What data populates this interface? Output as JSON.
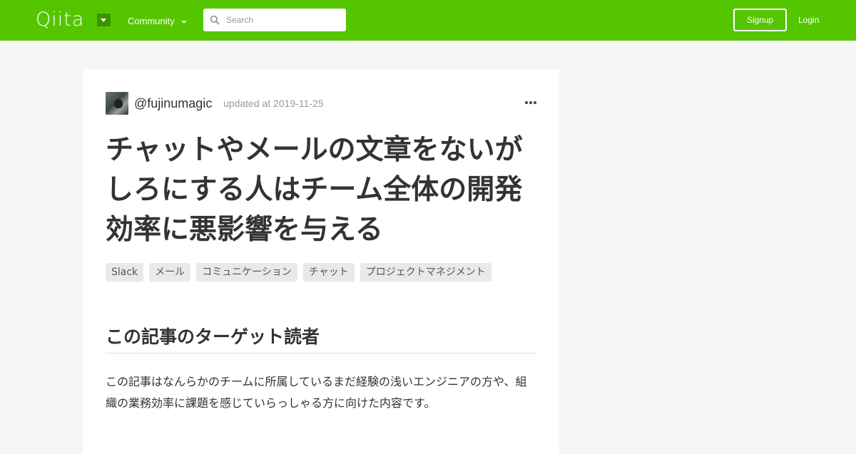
{
  "header": {
    "logo": "Qiita",
    "community_label": "Community",
    "search_placeholder": "Search",
    "signup_label": "Signup",
    "login_label": "Login",
    "brand_color": "#55c500"
  },
  "article": {
    "author": "@fujinumagic",
    "updated": "updated at 2019-11-25",
    "title": "チャットやメールの文章をないがしろにする人はチーム全体の開発効率に悪影響を与える",
    "tags": [
      "Slack",
      "メール",
      "コミュニケーション",
      "チャット",
      "プロジェクトマネジメント"
    ],
    "section_heading": "この記事のターゲット読者",
    "paragraph": "この記事はなんらかのチームに所属しているまだ経験の浅いエンジニアの方や、組織の業務効率に課題を感じていらっしゃる方に向けた内容です。"
  }
}
